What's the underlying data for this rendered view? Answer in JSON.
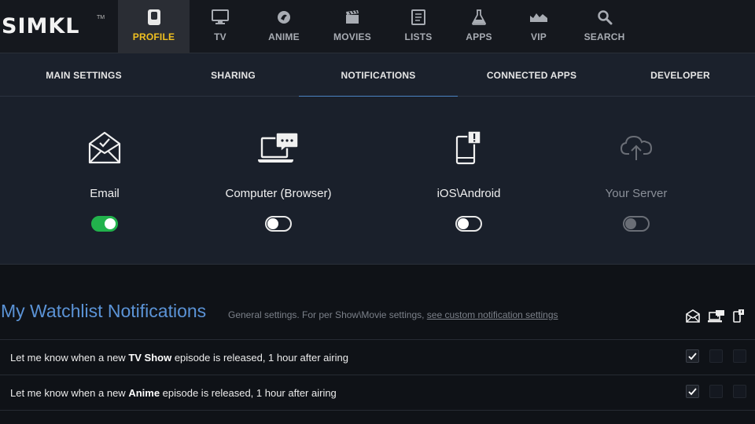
{
  "brand": {
    "logo_text": "SIMKL",
    "tm": "TM"
  },
  "nav": {
    "items": [
      {
        "label": "PROFILE",
        "icon": "profile-icon",
        "active": true
      },
      {
        "label": "TV",
        "icon": "tv-icon"
      },
      {
        "label": "ANIME",
        "icon": "anime-icon"
      },
      {
        "label": "MOVIES",
        "icon": "movies-icon"
      },
      {
        "label": "LISTS",
        "icon": "lists-icon"
      },
      {
        "label": "APPS",
        "icon": "apps-icon"
      },
      {
        "label": "VIP",
        "icon": "vip-icon"
      },
      {
        "label": "SEARCH",
        "icon": "search-icon"
      }
    ]
  },
  "subnav": {
    "tabs": [
      {
        "label": "MAIN SETTINGS"
      },
      {
        "label": "SHARING"
      },
      {
        "label": "NOTIFICATIONS",
        "active": true
      },
      {
        "label": "CONNECTED APPS"
      },
      {
        "label": "DEVELOPER"
      }
    ]
  },
  "channels": [
    {
      "label": "Email",
      "icon": "email-icon",
      "enabled": true
    },
    {
      "label": "Computer (Browser)",
      "icon": "computer-browser-icon",
      "enabled": false
    },
    {
      "label": "iOS\\Android",
      "icon": "mobile-icon",
      "enabled": false
    },
    {
      "label": "Your Server",
      "icon": "cloud-upload-icon",
      "enabled": false,
      "disabled": true
    }
  ],
  "watchlist": {
    "title": "My Watchlist Notifications",
    "desc_prefix": "General settings. For per Show\\Movie settings, ",
    "desc_link": "see custom notification settings",
    "rows": [
      {
        "pre": "Let me know when a new ",
        "bold": "TV Show",
        "post": " episode is released, 1 hour after airing",
        "email": true,
        "browser": false,
        "mobile": false
      },
      {
        "pre": "Let me know when a new ",
        "bold": "Anime",
        "post": " episode is released, 1 hour after airing",
        "email": true,
        "browser": false,
        "mobile": false
      }
    ]
  },
  "colors": {
    "accent": "#f0c020",
    "link": "#5b93d6",
    "toggle_on": "#22b24c",
    "tab_underline": "#4b83c4"
  }
}
